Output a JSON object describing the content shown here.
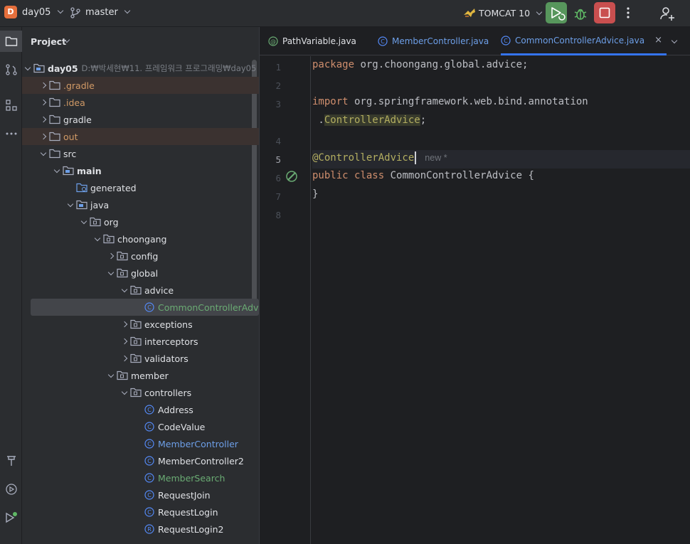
{
  "topbar": {
    "project_badge": "D",
    "project_name": "day05",
    "branch": "master",
    "run_config": "TOMCAT 10",
    "colors": {
      "run": "#57965c",
      "stop": "#c94f4f",
      "badge": "#e56f3c"
    }
  },
  "toolstrip": {
    "items": [
      "folder-icon",
      "git-commit-icon",
      "structure-icon",
      "more-icon",
      "hammer-icon",
      "services-icon",
      "run-icon"
    ]
  },
  "project_panel": {
    "title": "Project",
    "root": {
      "name": "day05",
      "path": "D:₩박세현₩11. 프레임워크 프로그래밍₩day05"
    },
    "items": [
      {
        "label": ".gradle",
        "style": "orange",
        "excluded": true
      },
      {
        "label": ".idea",
        "style": "orange"
      },
      {
        "label": "gradle",
        "style": "normal"
      },
      {
        "label": "out",
        "style": "orange",
        "excluded": true
      },
      {
        "label": "src",
        "style": "normal"
      },
      {
        "label": "main",
        "style": "bold"
      },
      {
        "label": "generated",
        "style": "normal"
      },
      {
        "label": "java",
        "style": "normal"
      },
      {
        "label": "org",
        "style": "normal"
      },
      {
        "label": "choongang",
        "style": "normal"
      },
      {
        "label": "config",
        "style": "normal"
      },
      {
        "label": "global",
        "style": "normal"
      },
      {
        "label": "advice",
        "style": "normal"
      },
      {
        "label": "CommonControllerAdvice",
        "style": "green",
        "selected": true
      },
      {
        "label": "exceptions",
        "style": "normal"
      },
      {
        "label": "interceptors",
        "style": "normal"
      },
      {
        "label": "validators",
        "style": "normal"
      },
      {
        "label": "member",
        "style": "normal"
      },
      {
        "label": "controllers",
        "style": "normal"
      },
      {
        "label": "Address",
        "style": "normal"
      },
      {
        "label": "CodeValue",
        "style": "normal"
      },
      {
        "label": "MemberController",
        "style": "blue"
      },
      {
        "label": "MemberController2",
        "style": "normal"
      },
      {
        "label": "MemberSearch",
        "style": "green"
      },
      {
        "label": "RequestJoin",
        "style": "normal"
      },
      {
        "label": "RequestLogin",
        "style": "normal"
      },
      {
        "label": "RequestLogin2",
        "style": "normal"
      }
    ]
  },
  "editor": {
    "tabs": [
      {
        "label": "PathVariable.java",
        "icon": "annotation-icon",
        "active": false
      },
      {
        "label": "MemberController.java",
        "icon": "class-icon",
        "active": false
      },
      {
        "label": "CommonControllerAdvice.java",
        "icon": "class-icon",
        "active": true
      }
    ],
    "close_glyph": "×",
    "line_numbers": [
      "1",
      "2",
      "3",
      "4",
      "5",
      "6",
      "7",
      "8"
    ],
    "code": {
      "line1_kw": "package",
      "line1_rest": " org.choongang.global.advice;",
      "line3_kw": "import",
      "line3_rest": " org.springframework.web.bind.annotation",
      "line3b_dot": " .",
      "line3b_name": "ControllerAdvice",
      "line3b_end": ";",
      "line5_ann": "@ControllerAdvice",
      "line5_inlay": "new *",
      "line6_kw1": "public",
      "line6_kw2": "class",
      "line6_rest": " CommonControllerAdvice {",
      "line7": "}"
    }
  }
}
